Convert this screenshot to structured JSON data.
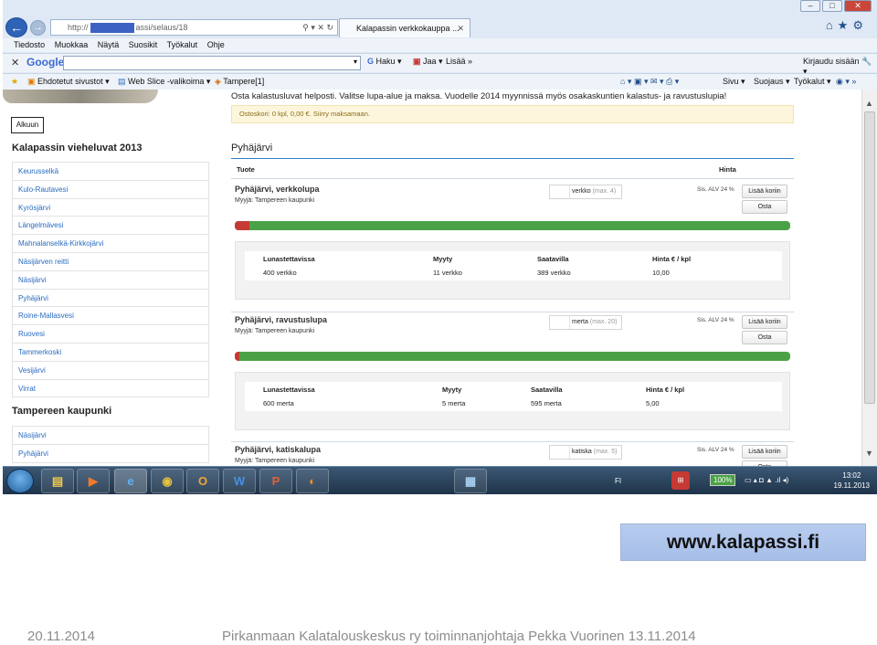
{
  "browser": {
    "address_prefix": "http://",
    "address_suffix": "assi/selaus/18",
    "tab_title": "Kalapassin verkkokauppa ...",
    "menu": [
      "Tiedosto",
      "Muokkaa",
      "Näytä",
      "Suosikit",
      "Työkalut",
      "Ohje"
    ],
    "google": {
      "logo": "Google",
      "haku": "Haku",
      "jaa": "Jaa",
      "lisaa": "Lisää »",
      "kirjaudu": "Kirjaudu sisään"
    },
    "favorites": {
      "ehdotetut": "Ehdotetut sivustot ▾",
      "webslice": "Web Slice -valikoima ▾",
      "tampere": "Tampere[1]"
    },
    "cmd": {
      "sivu": "Sivu ▾",
      "suojaus": "Suojaus ▾",
      "tyokalut": "Työkalut ▾"
    }
  },
  "page": {
    "intro": "Osta kalastusluvat helposti. Valitse lupa-alue ja maksa. Vuodelle 2014 myynnissä myös osakaskuntien kalastus- ja ravustuslupia!",
    "cart": "Ostoskori: 0 kpl, 0,00 €. Siirry maksamaan.",
    "alkuun": "Alkuun",
    "sidebar_title": "Kalapassin vieheluvat 2013",
    "sidebar_items": [
      "Keurusselkä",
      "Kulo-Rautavesi",
      "Kyrösjärvi",
      "Längelmävesi",
      "Mahnalanselkä-Kirkkojärvi",
      "Näsijärven reitti",
      "Näsijärvi",
      "Pyhäjärvi",
      "Roine-Mallasvesi",
      "Ruovesi",
      "Tammerkoski",
      "Vesijärvi",
      "Virrat"
    ],
    "sidebar2_title": "Tampereen kaupunki",
    "sidebar2_items": [
      "Näsijärvi",
      "Pyhäjärvi"
    ],
    "lake_title": "Pyhäjärvi",
    "col_product": "Tuote",
    "col_price": "Hinta",
    "detail_headers": [
      "Lunastettavissa",
      "Myyty",
      "Saatavilla",
      "Hinta € / kpl"
    ],
    "vat": "Sis. ALV 24 %",
    "add_label": "Lisää koriin",
    "buy_label": "Osta",
    "products": [
      {
        "name": "Pyhäjärvi, verkkolupa",
        "seller": "Myyjä: Tampereen kaupunki",
        "unit": "verkko",
        "max": "(max. 4)",
        "sold_fraction": 0.027,
        "cells": [
          "400 verkko",
          "11 verkko",
          "389 verkko",
          "10,00"
        ]
      },
      {
        "name": "Pyhäjärvi, ravustuslupa",
        "seller": "Myyjä: Tampereen kaupunki",
        "unit": "merta",
        "max": "(max. 20)",
        "sold_fraction": 0.008,
        "cells": [
          "600 merta",
          "5 merta",
          "595 merta",
          "5,00"
        ]
      },
      {
        "name": "Pyhäjärvi, katiskalupa",
        "seller": "Myyjä: Tampereen kaupunki",
        "unit": "katiska",
        "max": "(max. 5)"
      }
    ]
  },
  "taskbar": {
    "lang": "FI",
    "battery": "100%",
    "time": "13:02",
    "date": "19.11.2013"
  },
  "slide": {
    "url": "www.kalapassi.fi",
    "date": "20.11.2014",
    "footer": "Pirkanmaan Kalatalouskeskus ry toiminnanjohtaja Pekka Vuorinen 13.11.2014"
  }
}
